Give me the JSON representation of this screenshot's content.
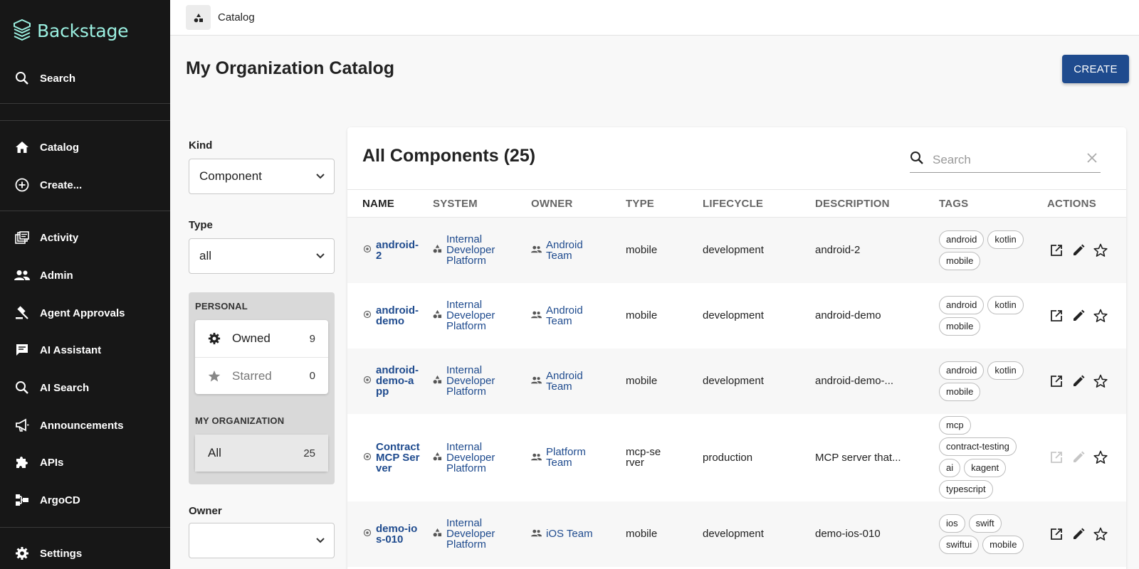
{
  "app": {
    "title": "Backstage"
  },
  "sidebar": {
    "search_label": "Search",
    "items": [
      {
        "label": "Catalog",
        "icon": "home-icon"
      },
      {
        "label": "Create...",
        "icon": "plus-circle-icon"
      },
      {
        "label": "Activity",
        "icon": "activity-icon"
      },
      {
        "label": "Admin",
        "icon": "people-icon"
      },
      {
        "label": "Agent Approvals",
        "icon": "gavel-icon"
      },
      {
        "label": "AI Assistant",
        "icon": "chat-icon"
      },
      {
        "label": "AI Search",
        "icon": "search-icon"
      },
      {
        "label": "Announcements",
        "icon": "megaphone-icon"
      },
      {
        "label": "APIs",
        "icon": "puzzle-icon"
      },
      {
        "label": "ArgoCD",
        "icon": "argocd-icon"
      }
    ],
    "settings_label": "Settings"
  },
  "breadcrumb": {
    "label": "Catalog"
  },
  "page": {
    "title": "My Organization Catalog",
    "create_label": "CREATE"
  },
  "filters": {
    "kind_label": "Kind",
    "kind_value": "Component",
    "type_label": "Type",
    "type_value": "all",
    "personal_heading": "PERSONAL",
    "owned_label": "Owned",
    "owned_count": "9",
    "starred_label": "Starred",
    "starred_count": "0",
    "org_heading": "MY ORGANIZATION",
    "all_label": "All",
    "all_count": "25",
    "owner_label": "Owner",
    "owner_value": ""
  },
  "table": {
    "title": "All Components (25)",
    "search_placeholder": "Search",
    "columns": [
      "NAME",
      "SYSTEM",
      "OWNER",
      "TYPE",
      "LIFECYCLE",
      "DESCRIPTION",
      "TAGS",
      "ACTIONS"
    ],
    "rows": [
      {
        "name": "android-2",
        "system": "Internal Developer Platform",
        "owner": "Android Team",
        "type": "mobile",
        "lifecycle": "development",
        "description": "android-2",
        "tags": [
          "android",
          "kotlin",
          "mobile"
        ],
        "actions_enabled": true
      },
      {
        "name": "android-demo",
        "system": "Internal Developer Platform",
        "owner": "Android Team",
        "type": "mobile",
        "lifecycle": "development",
        "description": "android-demo",
        "tags": [
          "android",
          "kotlin",
          "mobile"
        ],
        "actions_enabled": true
      },
      {
        "name": "android-demo-app",
        "system": "Internal Developer Platform",
        "owner": "Android Team",
        "type": "mobile",
        "lifecycle": "development",
        "description": "android-demo-...",
        "tags": [
          "android",
          "kotlin",
          "mobile"
        ],
        "actions_enabled": true
      },
      {
        "name": "Contract MCP Server",
        "system": "Internal Developer Platform",
        "owner": "Platform Team",
        "type": "mcp-server",
        "lifecycle": "production",
        "description": "MCP server that...",
        "tags": [
          "mcp",
          "contract-testing",
          "ai",
          "kagent",
          "typescript"
        ],
        "actions_enabled": false
      },
      {
        "name": "demo-ios-010",
        "system": "Internal Developer Platform",
        "owner": "iOS Team",
        "type": "mobile",
        "lifecycle": "development",
        "description": "demo-ios-010",
        "tags": [
          "ios",
          "swift",
          "swiftui",
          "mobile"
        ],
        "actions_enabled": true
      }
    ]
  },
  "colors": {
    "sidebar_bg": "#171717",
    "logo": "#9bf0e1",
    "accent": "#1f4b8e"
  }
}
